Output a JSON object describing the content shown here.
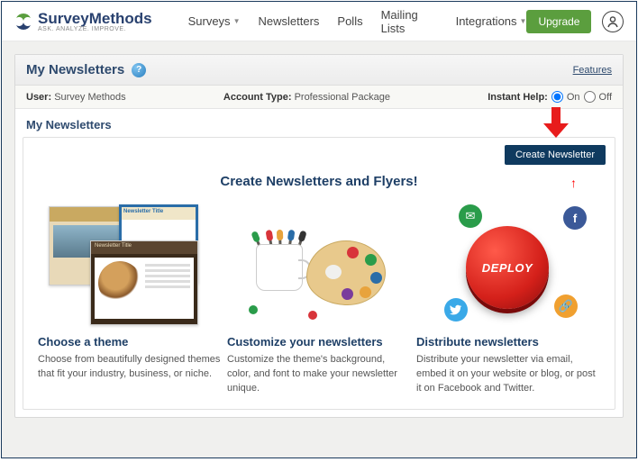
{
  "brand": {
    "name": "SurveyMethods",
    "tagline": "ASK. ANALYZE. IMPROVE."
  },
  "nav": {
    "surveys": "Surveys",
    "newsletters": "Newsletters",
    "polls": "Polls",
    "mailing": "Mailing Lists",
    "integrations": "Integrations",
    "upgrade": "Upgrade"
  },
  "panel": {
    "title": "My Newsletters",
    "features": "Features"
  },
  "meta": {
    "userLabel": "User:",
    "user": "Survey Methods",
    "acctLabel": "Account Type:",
    "acct": "Professional Package",
    "instant": "Instant Help:",
    "on": "On",
    "off": "Off"
  },
  "sub": "My Newsletters",
  "createBtn": "Create Newsletter",
  "hero": "Create Newsletters and Flyers!",
  "col1": {
    "h": "Choose a theme",
    "p": "Choose from beautifully designed themes that fit your industry, business, or niche.",
    "t": "Newsletter Title"
  },
  "col2": {
    "h": "Customize your newsletters",
    "p": "Customize the theme's background, color, and font to make your newsletter unique."
  },
  "col3": {
    "h": "Distribute newsletters",
    "p": "Distribute your newsletter via email, embed it on your website or blog, or post it on Facebook and Twitter.",
    "deploy": "DEPLOY"
  }
}
